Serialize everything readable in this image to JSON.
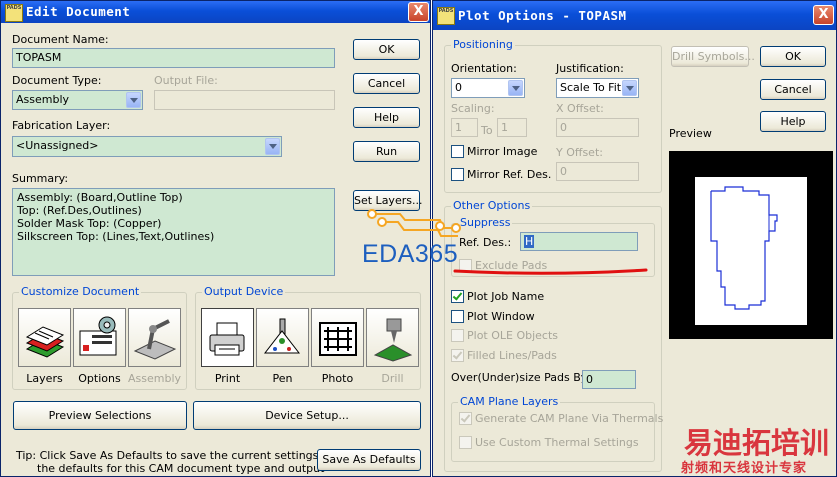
{
  "edit_dialog": {
    "title": "Edit Document",
    "icon_text": "PADS",
    "close_label": "X",
    "document_name_label": "Document Name:",
    "document_name_value": "TOPASM",
    "document_type_label": "Document Type:",
    "document_type_value": "Assembly",
    "output_file_label": "Output File:",
    "output_file_value": "",
    "fabrication_layer_label": "Fabrication Layer:",
    "fabrication_layer_value": "<Unassigned>",
    "summary_label": "Summary:",
    "summary_lines": [
      "Assembly: (Board,Outline Top)",
      "Top: (Ref.Des,Outlines)",
      "Solder Mask Top: (Copper)",
      "Silkscreen Top: (Lines,Text,Outlines)"
    ],
    "buttons": {
      "ok": "OK",
      "cancel": "Cancel",
      "help": "Help",
      "run": "Run",
      "set_layers": "Set Layers..."
    },
    "customize_group": "Customize Document",
    "customize_items": [
      "Layers",
      "Options",
      "Assembly"
    ],
    "output_group": "Output Device",
    "output_items": [
      "Print",
      "Pen",
      "Photo",
      "Drill"
    ],
    "preview_selections": "Preview Selections",
    "device_setup": "Device Setup...",
    "tip_line1": "Tip: Click Save As Defaults to save the current settings as",
    "tip_line2": "the defaults for this CAM document type and output",
    "save_as_defaults": "Save As Defaults"
  },
  "plot_dialog": {
    "title": "Plot Options - TOPASM",
    "icon_text": "PADS",
    "close_label": "X",
    "positioning_group": "Positioning",
    "orientation_label": "Orientation:",
    "orientation_value": "0",
    "justification_label": "Justification:",
    "justification_value": "Scale To Fit",
    "scaling_label": "Scaling:",
    "scaling_from": "1",
    "scaling_to_label": "To",
    "scaling_to": "1",
    "x_offset_label": "X Offset:",
    "x_offset_value": "0",
    "y_offset_label": "Y Offset:",
    "y_offset_value": "0",
    "mirror_image": "Mirror Image",
    "mirror_ref_des": "Mirror Ref. Des.",
    "other_options_group": "Other Options",
    "suppress_group": "Suppress",
    "ref_des_label": "Ref. Des.:",
    "ref_des_value": "H",
    "exclude_pads": "Exclude Pads",
    "plot_job_name": "Plot Job Name",
    "plot_job_name_checked": true,
    "plot_window": "Plot Window",
    "plot_ole_objects": "Plot OLE Objects",
    "filled_lines_pads": "Filled Lines/Pads",
    "filled_lines_pads_checked": true,
    "oversize_label": "Over(Under)size Pads By:",
    "oversize_value": "0",
    "cam_plane_group": "CAM Plane Layers",
    "generate_cam_plane": "Generate CAM Plane Via Thermals",
    "generate_cam_plane_checked": true,
    "use_custom_thermal": "Use Custom Thermal Settings",
    "drill_symbols": "Drill Symbols...",
    "ok": "OK",
    "cancel": "Cancel",
    "help": "Help",
    "preview_label": "Preview"
  },
  "watermarks": {
    "eda365": "EDA365",
    "cn_title": "易迪拓培训",
    "cn_subtitle": "射频和天线设计专家"
  },
  "colors": {
    "title_bar": "#0a4fd8",
    "dialog_bg": "#ece9d8",
    "field_bg": "#cfe8d2",
    "group_title": "#0046d5",
    "annotation_orange": "#f5a623",
    "annotation_red": "#e01010",
    "watermark_blue": "#1d5fbf",
    "watermark_red": "#d9363e"
  }
}
